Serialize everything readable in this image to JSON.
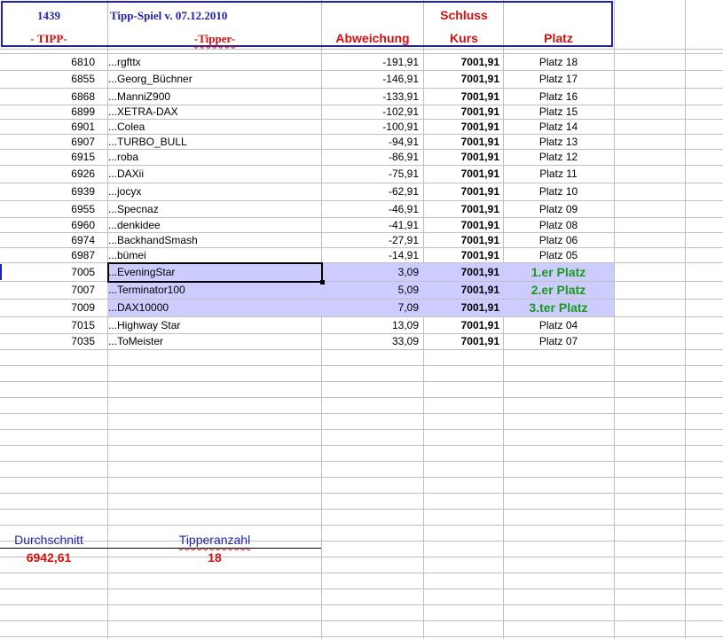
{
  "header": {
    "id": "1439",
    "title": "Tipp-Spiel v. 07.12.2010",
    "schluss": "Schluss",
    "col_tipp": "- TIPP-",
    "col_tipper": "-Tipper-",
    "col_abweichung": "Abweichung",
    "col_kurs": "Kurs",
    "col_platz": "Platz"
  },
  "rows": [
    {
      "tipp": "6810",
      "tipper": "...rgfttx",
      "abw": "-191,91",
      "kurs": "7001,91",
      "platz": "Platz 18"
    },
    {
      "tipp": "6855",
      "tipper": "...Georg_Büchner",
      "abw": "-146,91",
      "kurs": "7001,91",
      "platz": "Platz 17"
    },
    {
      "tipp": "6868",
      "tipper": "...ManniZ900",
      "abw": "-133,91",
      "kurs": "7001,91",
      "platz": "Platz 16"
    },
    {
      "tipp": "6899",
      "tipper": "...XETRA-DAX",
      "abw": "-102,91",
      "kurs": "7001,91",
      "platz": "Platz 15"
    },
    {
      "tipp": "6901",
      "tipper": "...Colea",
      "abw": "-100,91",
      "kurs": "7001,91",
      "platz": "Platz 14"
    },
    {
      "tipp": "6907",
      "tipper": "...TURBO_BULL",
      "abw": "-94,91",
      "kurs": "7001,91",
      "platz": "Platz 13"
    },
    {
      "tipp": "6915",
      "tipper": "...roba",
      "abw": "-86,91",
      "kurs": "7001,91",
      "platz": "Platz 12"
    },
    {
      "tipp": "6926",
      "tipper": "...DAXii",
      "abw": "-75,91",
      "kurs": "7001,91",
      "platz": "Platz 11"
    },
    {
      "tipp": "6939",
      "tipper": "...jocyx",
      "abw": "-62,91",
      "kurs": "7001,91",
      "platz": "Platz 10"
    },
    {
      "tipp": "6955",
      "tipper": "...Specnaz",
      "abw": "-46,91",
      "kurs": "7001,91",
      "platz": "Platz 09"
    },
    {
      "tipp": "6960",
      "tipper": "...denkidee",
      "abw": "-41,91",
      "kurs": "7001,91",
      "platz": "Platz 08"
    },
    {
      "tipp": "6974",
      "tipper": "...BackhandSmash",
      "abw": "-27,91",
      "kurs": "7001,91",
      "platz": "Platz 06"
    },
    {
      "tipp": "6987",
      "tipper": "...bümei",
      "abw": "-14,91",
      "kurs": "7001,91",
      "platz": "Platz 05"
    },
    {
      "tipp": "7005",
      "tipper": "...EveningStar",
      "abw": "3,09",
      "kurs": "7001,91",
      "platz": "1.er Platz",
      "winner": true
    },
    {
      "tipp": "7007",
      "tipper": "...Terminator100",
      "abw": "5,09",
      "kurs": "7001,91",
      "platz": "2.er Platz",
      "winner": true
    },
    {
      "tipp": "7009",
      "tipper": "...DAX10000",
      "abw": "7,09",
      "kurs": "7001,91",
      "platz": "3.ter Platz",
      "winner": true
    },
    {
      "tipp": "7015",
      "tipper": "...Highway Star",
      "abw": "13,09",
      "kurs": "7001,91",
      "platz": "Platz 04"
    },
    {
      "tipp": "7035",
      "tipper": "...ToMeister",
      "abw": "33,09",
      "kurs": "7001,91",
      "platz": "Platz 07"
    }
  ],
  "footer": {
    "avg_label": "Durchschnitt",
    "avg_value": "6942,61",
    "count_label": "Tipperanzahl",
    "count_value": "18"
  },
  "colors": {
    "header_blue": "#1f1fb0",
    "header_red": "#d41010",
    "winner_bg": "#ccccff",
    "winner_text": "#1a9a1a",
    "gridline": "#c0c0c0"
  }
}
